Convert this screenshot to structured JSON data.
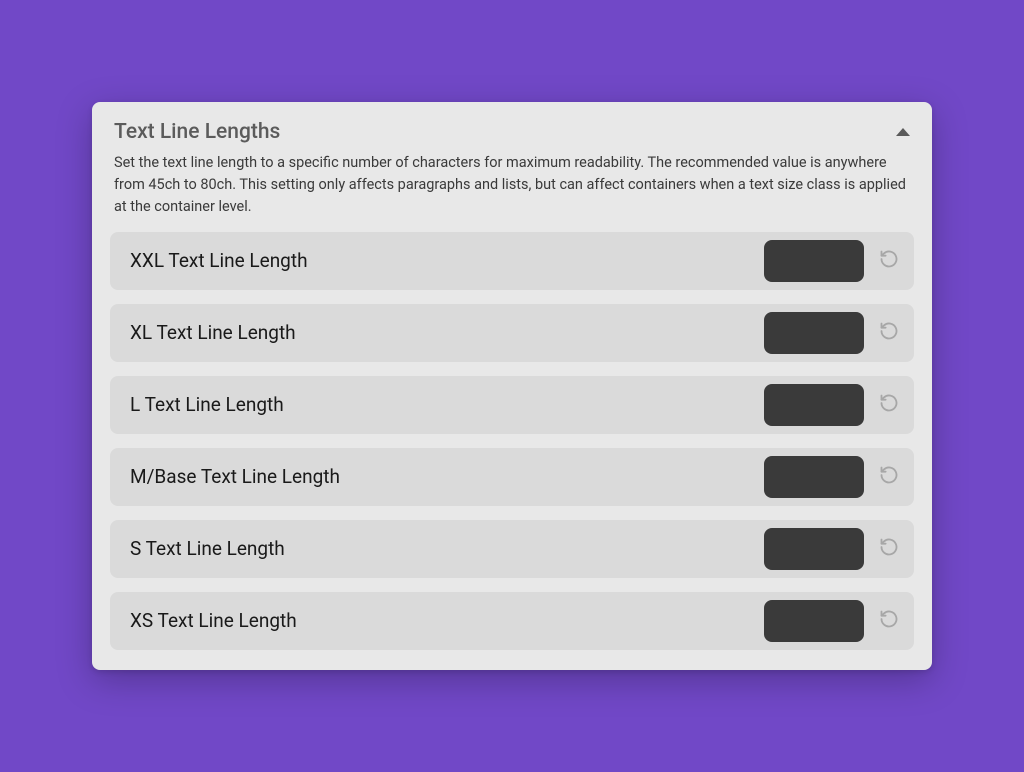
{
  "panel": {
    "title": "Text Line Lengths",
    "description": "Set the text line length to a specific number of characters for maximum readability. The recommended value is anywhere from 45ch to 80ch. This setting only affects paragraphs and lists, but can affect containers when a text size class is applied at the container level."
  },
  "rows": [
    {
      "label": "XXL Text Line Length",
      "value": ""
    },
    {
      "label": "XL Text Line Length",
      "value": ""
    },
    {
      "label": "L Text Line Length",
      "value": ""
    },
    {
      "label": "M/Base Text Line Length",
      "value": ""
    },
    {
      "label": "S Text Line Length",
      "value": ""
    },
    {
      "label": "XS Text Line Length",
      "value": ""
    }
  ]
}
